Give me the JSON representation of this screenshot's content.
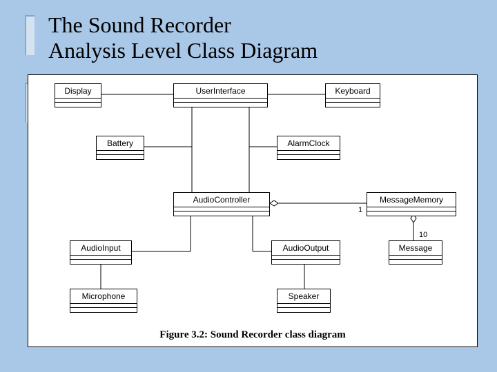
{
  "title_line1": "The Sound Recorder",
  "title_line2": "Analysis Level Class Diagram",
  "classes": {
    "display": "Display",
    "user_interface": "UserInterface",
    "keyboard": "Keyboard",
    "battery": "Battery",
    "alarm_clock": "AlarmClock",
    "audio_controller": "AudioController",
    "message_memory": "MessageMemory",
    "audio_input": "AudioInput",
    "audio_output": "AudioOutput",
    "message": "Message",
    "microphone": "Microphone",
    "speaker": "Speaker"
  },
  "multiplicities": {
    "mm_to_ac": "1",
    "msg_to_mm": "10"
  },
  "caption": "Figure 3.2: Sound Recorder class diagram",
  "chart_data": {
    "type": "uml-class-diagram",
    "title": "Sound Recorder class diagram",
    "classes": [
      "Display",
      "UserInterface",
      "Keyboard",
      "Battery",
      "AlarmClock",
      "AudioController",
      "MessageMemory",
      "AudioInput",
      "AudioOutput",
      "Message",
      "Microphone",
      "Speaker"
    ],
    "associations": [
      {
        "from": "UserInterface",
        "to": "Display"
      },
      {
        "from": "UserInterface",
        "to": "Keyboard"
      },
      {
        "from": "UserInterface",
        "to": "Battery"
      },
      {
        "from": "UserInterface",
        "to": "AlarmClock"
      },
      {
        "from": "UserInterface",
        "to": "AudioController"
      },
      {
        "from": "AudioController",
        "to": "AudioInput"
      },
      {
        "from": "AudioController",
        "to": "AudioOutput"
      },
      {
        "from": "AudioInput",
        "to": "Microphone"
      },
      {
        "from": "AudioOutput",
        "to": "Speaker"
      }
    ],
    "aggregations": [
      {
        "whole": "AudioController",
        "part": "MessageMemory",
        "multiplicity_part": "1"
      },
      {
        "whole": "MessageMemory",
        "part": "Message",
        "multiplicity_part": "10"
      }
    ]
  }
}
